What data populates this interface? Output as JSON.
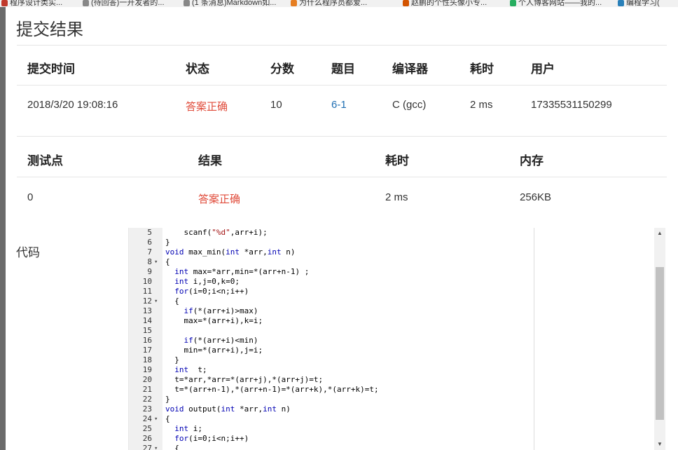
{
  "bookmarks": [
    {
      "label": "程序设计类实...",
      "color": "#c0392b"
    },
    {
      "label": "(待回答)一开发者的...",
      "color": "#888888"
    },
    {
      "label": "(1 条消息)Markdown如...",
      "color": "#888888"
    },
    {
      "label": "为什么程序员都爱...",
      "color": "#e67e22"
    },
    {
      "label": "赵鹏的个性头像小专...",
      "color": "#d35400"
    },
    {
      "label": "个人博客网站——我的...",
      "color": "#27ae60"
    },
    {
      "label": "编程学习(",
      "color": "#2980b9"
    }
  ],
  "modal": {
    "title": "提交结果",
    "submission_table": {
      "headers": [
        "提交时间",
        "状态",
        "分数",
        "题目",
        "编译器",
        "耗时",
        "用户"
      ],
      "row": {
        "time": "2018/3/20 19:08:16",
        "status": "答案正确",
        "score": "10",
        "problem": "6-1",
        "compiler": "C (gcc)",
        "duration": "2 ms",
        "user": "17335531150299"
      }
    },
    "test_table": {
      "headers": [
        "测试点",
        "结果",
        "耗时",
        "内存"
      ],
      "row": {
        "case": "0",
        "result": "答案正确",
        "duration": "2 ms",
        "memory": "256KB"
      }
    },
    "code_label": "代码",
    "code_lines": [
      {
        "n": "5",
        "fold": "",
        "text": "    scanf(\"%d\",arr+i);"
      },
      {
        "n": "6",
        "fold": "",
        "text": "}"
      },
      {
        "n": "7",
        "fold": "",
        "text": "void max_min(int *arr,int n)"
      },
      {
        "n": "8",
        "fold": "▾",
        "text": "{"
      },
      {
        "n": "9",
        "fold": "",
        "text": "  int max=*arr,min=*(arr+n-1) ;"
      },
      {
        "n": "10",
        "fold": "",
        "text": "  int i,j=0,k=0;"
      },
      {
        "n": "11",
        "fold": "",
        "text": "  for(i=0;i<n;i++)"
      },
      {
        "n": "12",
        "fold": "▾",
        "text": "  {"
      },
      {
        "n": "13",
        "fold": "",
        "text": "    if(*(arr+i)>max)"
      },
      {
        "n": "14",
        "fold": "",
        "text": "    max=*(arr+i),k=i;"
      },
      {
        "n": "15",
        "fold": "",
        "text": ""
      },
      {
        "n": "16",
        "fold": "",
        "text": "    if(*(arr+i)<min)"
      },
      {
        "n": "17",
        "fold": "",
        "text": "    min=*(arr+i),j=i;"
      },
      {
        "n": "18",
        "fold": "",
        "text": "  }"
      },
      {
        "n": "19",
        "fold": "",
        "text": "  int  t;"
      },
      {
        "n": "20",
        "fold": "",
        "text": "  t=*arr,*arr=*(arr+j),*(arr+j)=t;"
      },
      {
        "n": "21",
        "fold": "",
        "text": "  t=*(arr+n-1),*(arr+n-1)=*(arr+k),*(arr+k)=t;"
      },
      {
        "n": "22",
        "fold": "",
        "text": "}"
      },
      {
        "n": "23",
        "fold": "",
        "text": "void output(int *arr,int n)"
      },
      {
        "n": "24",
        "fold": "▾",
        "text": "{"
      },
      {
        "n": "25",
        "fold": "",
        "text": "  int i;"
      },
      {
        "n": "26",
        "fold": "",
        "text": "  for(i=0;i<n;i++)"
      },
      {
        "n": "27",
        "fold": "▾",
        "text": "  {"
      }
    ],
    "scrollbar": {
      "up_icon": "▲",
      "down_icon": "▼"
    }
  },
  "colors": {
    "accepted": "#e04b3a",
    "problem_link": "#1f6fb3",
    "keyword": "#0000b3"
  }
}
